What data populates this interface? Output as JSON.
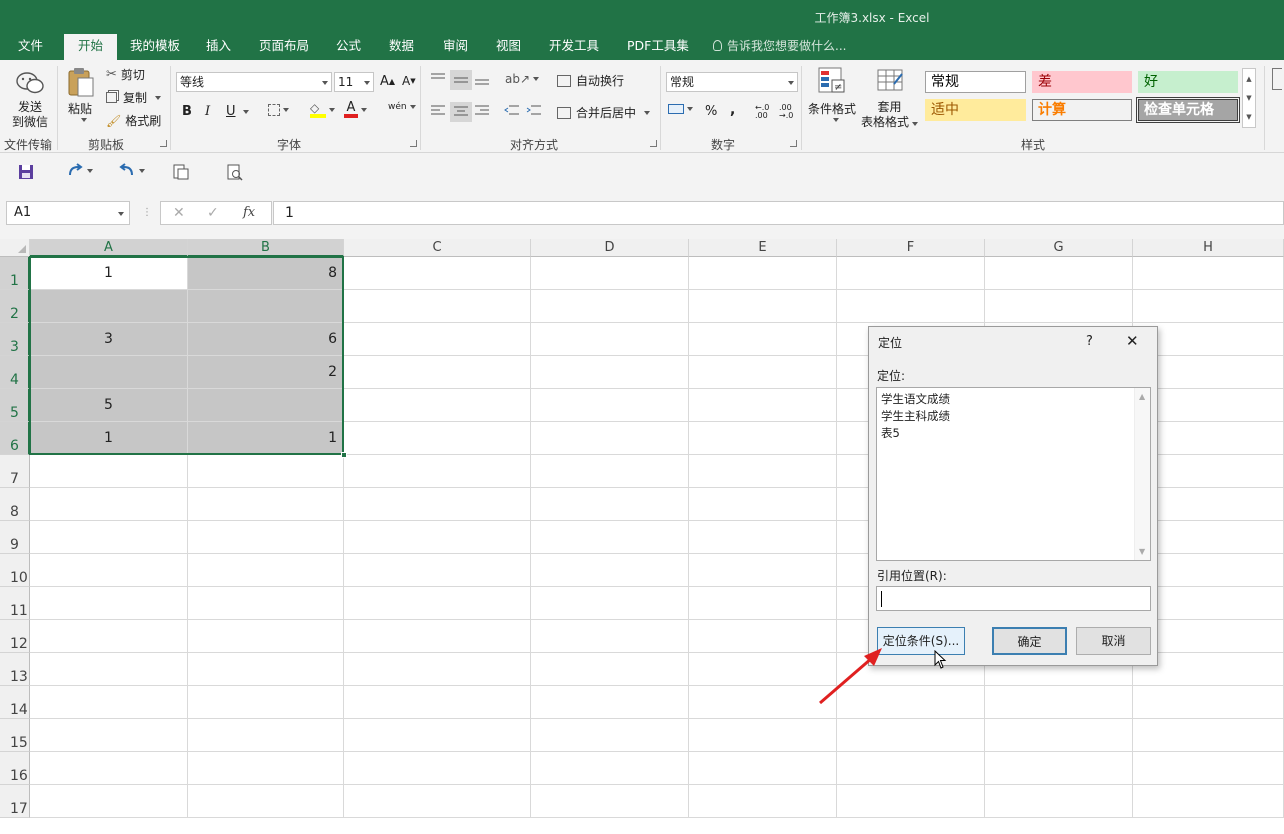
{
  "window": {
    "title": "工作簿3.xlsx  -  Excel"
  },
  "tabs": [
    "文件",
    "开始",
    "我的模板",
    "插入",
    "页面布局",
    "公式",
    "数据",
    "审阅",
    "视图",
    "开发工具",
    "PDF工具集"
  ],
  "tell_me": "告诉我您想要做什么...",
  "ribbon": {
    "send_wechat": [
      "发送",
      "到微信"
    ],
    "file_transfer": "文件传输",
    "paste": "粘贴",
    "cut": "剪切",
    "copy": "复制",
    "format_painter": "格式刷",
    "clipboard": "剪贴板",
    "font_name": "等线",
    "font_size": "11",
    "grow_font": "A",
    "shrink_font": "A",
    "bold": "B",
    "italic": "I",
    "underline": "U",
    "font_color": "A",
    "phonetic": "wén",
    "font_group": "字体",
    "wrap_text": "自动换行",
    "merge_center": "合并后居中",
    "align_group": "对齐方式",
    "number_format": "常规",
    "percent": "%",
    "comma": ",",
    "number_group": "数字",
    "cond_format": "条件格式",
    "table_format": [
      "套用",
      "表格格式"
    ],
    "styles": [
      {
        "label": "常规",
        "bg": "#ffffff",
        "fg": "#000000",
        "border": "#a0a0a0"
      },
      {
        "label": "差",
        "bg": "#ffc7ce",
        "fg": "#9c0006",
        "border": "#ffc7ce"
      },
      {
        "label": "好",
        "bg": "#c6efce",
        "fg": "#006100",
        "border": "#c6efce"
      },
      {
        "label": "适中",
        "bg": "#ffeb9c",
        "fg": "#9c5700",
        "border": "#ffeb9c"
      },
      {
        "label": "计算",
        "bg": "#f2f2f2",
        "fg": "#fa7d00",
        "border": "#7f7f7f"
      },
      {
        "label": "检查单元格",
        "bg": "#a5a5a5",
        "fg": "#ffffff",
        "border": "#3f3f3f"
      }
    ],
    "styles_group": "样式"
  },
  "formula_bar": {
    "name_box": "A1",
    "fx": "fx",
    "value": "1"
  },
  "columns": [
    "A",
    "B",
    "C",
    "D",
    "E",
    "F",
    "G",
    "H"
  ],
  "rows": [
    "1",
    "2",
    "3",
    "4",
    "5",
    "6",
    "7",
    "8",
    "9",
    "10",
    "11",
    "12",
    "13",
    "14",
    "15",
    "16",
    "17"
  ],
  "cells": {
    "A1": "1",
    "B1": "8",
    "A3": "3",
    "B3": "6",
    "B4": "2",
    "A5": "5",
    "A6": "1",
    "B6": "1"
  },
  "dialog": {
    "title": "定位",
    "help": "?",
    "goto_label": "定位:",
    "list": [
      "学生语文成绩",
      "学生主科成绩",
      "表5"
    ],
    "ref_label": "引用位置(R):",
    "ref_value": "",
    "special_button": "定位条件(S)...",
    "ok_button": "确定",
    "cancel_button": "取消"
  },
  "colors": {
    "excel_green": "#217346",
    "arrow_red": "#e02020"
  }
}
